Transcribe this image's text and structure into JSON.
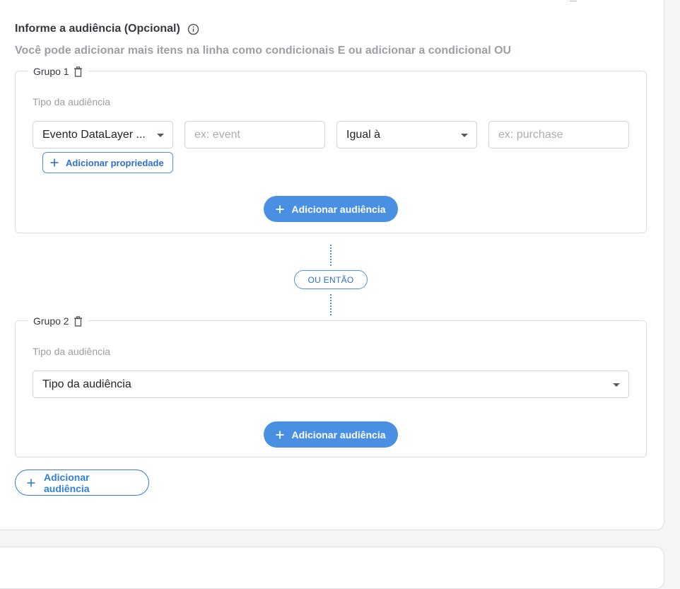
{
  "section": {
    "title": "Informe a audiência (Opcional)",
    "subtitle": "Você pode adicionar mais itens na linha como condicionais E ou adicionar a condicional OU"
  },
  "groups": [
    {
      "label": "Grupo 1",
      "field_label": "Tipo da audiência",
      "audience_type_value": "Evento DataLayer ...",
      "property_placeholder": "ex: event",
      "operator_value": "Igual à",
      "value_placeholder": "ex: purchase",
      "add_property_label": "Adicionar propriedade",
      "add_audience_label": "Adicionar audiência"
    },
    {
      "label": "Grupo 2",
      "field_label": "Tipo da audiência",
      "audience_type_value": "Tipo da audiência",
      "add_audience_label": "Adicionar audiência"
    }
  ],
  "or_separator": "OU ENTÃO",
  "add_group_label": "Adicionar audiência",
  "colors": {
    "primary": "#4a90e2",
    "primary_text": "#2f6fce",
    "muted_text": "#9aa0a6",
    "border": "#dcdfe4"
  },
  "icons": {
    "info": "info-icon",
    "trash": "trash-icon",
    "plus": "plus-icon",
    "caret": "chevron-down-icon"
  }
}
